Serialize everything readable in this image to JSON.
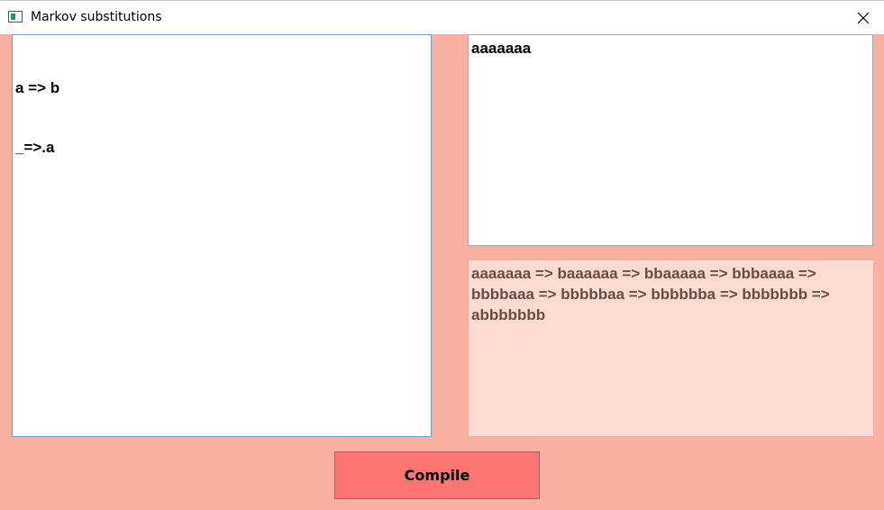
{
  "window": {
    "title": "Markov substitutions",
    "icons": {
      "app": "window-app-icon",
      "close": "close-icon"
    }
  },
  "rules_editor": {
    "lines": [
      "a => b",
      "_=>.a"
    ]
  },
  "input_box": {
    "value": "aaaaaaa"
  },
  "output_box": {
    "value": "aaaaaaa => baaaaaa => bbaaaaa => bbbaaaa => bbbbaaa => bbbbbaa => bbbbbba => bbbbbbb => abbbbbbb"
  },
  "compile_button": {
    "label": "Compile"
  },
  "colors": {
    "window_background": "#f9b09f",
    "output_background": "#fddbd3",
    "output_text": "#6e4a42",
    "compile_button_background": "#fe7672"
  }
}
